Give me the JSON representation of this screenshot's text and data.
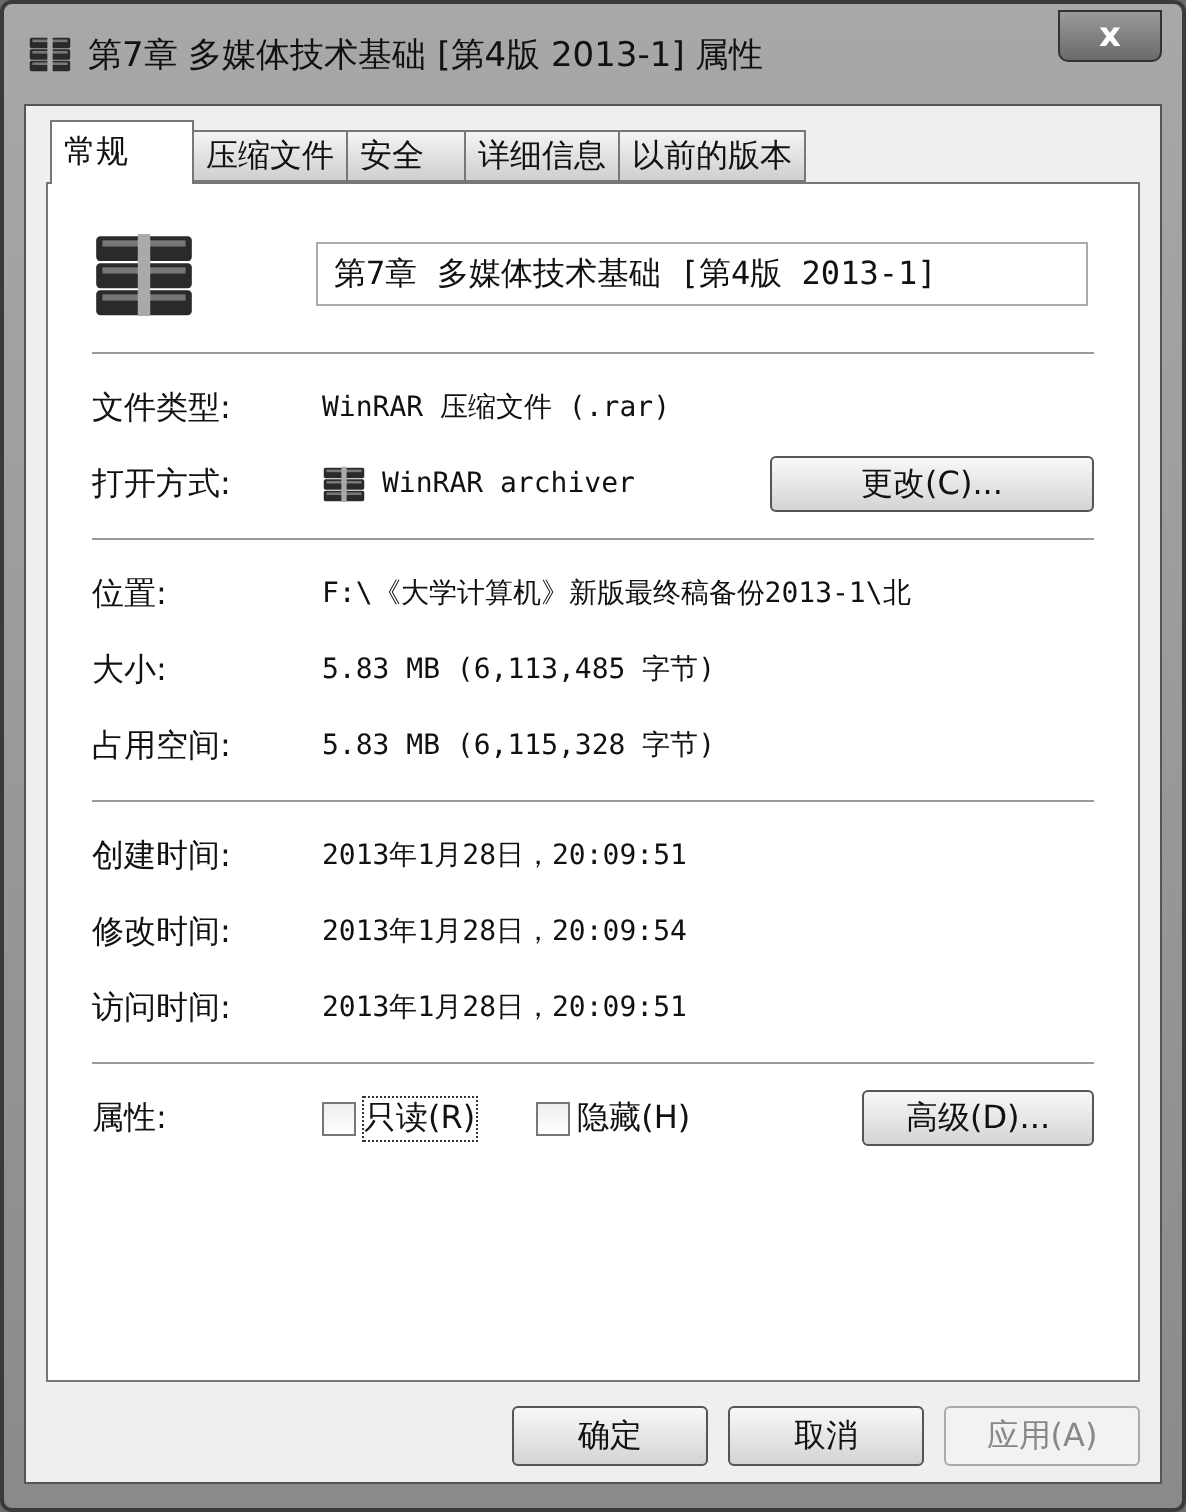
{
  "window": {
    "title": "第7章 多媒体技术基础 [第4版 2013-1] 属性",
    "close": "x"
  },
  "tabs": [
    {
      "label": "常规",
      "selected": true
    },
    {
      "label": "压缩文件",
      "selected": false
    },
    {
      "label": "安全",
      "selected": false
    },
    {
      "label": "详细信息",
      "selected": false
    },
    {
      "label": "以前的版本",
      "selected": false
    }
  ],
  "name_field": {
    "value": "第7章 多媒体技术基础 [第4版 2013-1]"
  },
  "sections": [
    [
      {
        "kind": "text",
        "label": "文件类型:",
        "value": "WinRAR 压缩文件 (.rar)"
      },
      {
        "kind": "app",
        "label": "打开方式:",
        "value": "WinRAR archiver",
        "button": "更改(C)..."
      }
    ],
    [
      {
        "kind": "text",
        "label": "位置:",
        "value": "F:\\《大学计算机》新版最终稿备份2013-1\\北"
      },
      {
        "kind": "text",
        "label": "大小:",
        "value": "5.83 MB (6,113,485 字节)"
      },
      {
        "kind": "text",
        "label": "占用空间:",
        "value": "5.83 MB (6,115,328 字节)"
      }
    ],
    [
      {
        "kind": "text",
        "label": "创建时间:",
        "value": "2013年1月28日，20:09:51"
      },
      {
        "kind": "text",
        "label": "修改时间:",
        "value": "2013年1月28日，20:09:54"
      },
      {
        "kind": "text",
        "label": "访问时间:",
        "value": "2013年1月28日，20:09:51"
      }
    ]
  ],
  "attributes": {
    "label": "属性:",
    "checkboxes": [
      {
        "label": "只读(R)",
        "checked": false,
        "focused": true
      },
      {
        "label": "隐藏(H)",
        "checked": false,
        "focused": false
      }
    ],
    "button": "高级(D)..."
  },
  "buttons": [
    {
      "label": "确定",
      "disabled": false
    },
    {
      "label": "取消",
      "disabled": false
    },
    {
      "label": "应用(A)",
      "disabled": true
    }
  ]
}
